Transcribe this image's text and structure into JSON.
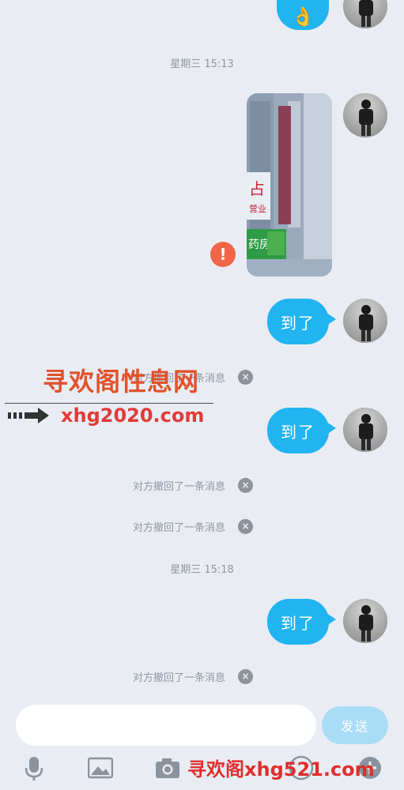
{
  "messages": {
    "timestamp_1": "星期三 15:13",
    "timestamp_2": "星期三 15:18",
    "bubble_1": "到了",
    "bubble_2": "到了",
    "bubble_3": "到了",
    "top_emoji": "👌",
    "recall_notice": "对方撤回了一条消息",
    "recall_close": "×",
    "error_mark": "!"
  },
  "input_bar": {
    "send_label": "发送",
    "placeholder": ""
  },
  "watermark": {
    "site_name": "寻欢阁性息网",
    "url": "xhg2020.com",
    "bottom": "寻欢阁xhg521.com"
  },
  "colors": {
    "background": "#e9edf3",
    "bubble": "#21b4f1",
    "send_button": "#a9ddf6",
    "error": "#f06548"
  },
  "icons": [
    "microphone-icon",
    "image-icon",
    "camera-icon",
    "emoji-icon",
    "plus-icon"
  ]
}
